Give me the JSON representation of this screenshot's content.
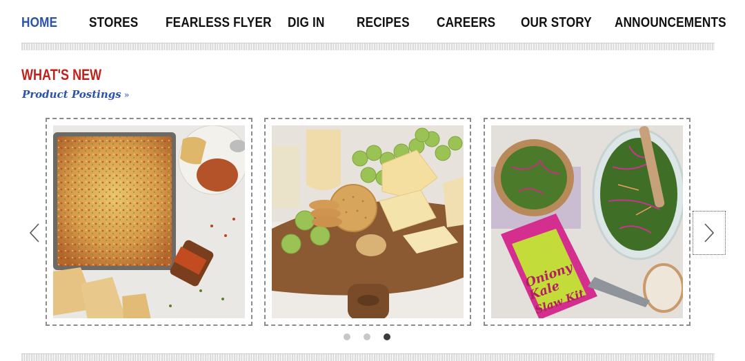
{
  "nav": {
    "items": [
      {
        "label": "HOME",
        "active": true
      },
      {
        "label": "STORES"
      },
      {
        "label": "FEARLESS FLYER"
      },
      {
        "label": "DIG IN"
      },
      {
        "label": "RECIPES"
      },
      {
        "label": "CAREERS"
      },
      {
        "label": "OUR STORY"
      },
      {
        "label": "ANNOUNCEMENTS"
      }
    ]
  },
  "section": {
    "heading": "WHAT'S NEW",
    "link_label": "Product Postings",
    "link_chevron": "»"
  },
  "carousel": {
    "slides": [
      {
        "name": "baked-cheese-dip-with-seasoning-jar",
        "description_icon": "food-photo"
      },
      {
        "name": "cheese-board-with-grapes-and-crackers",
        "description_icon": "food-photo"
      },
      {
        "name": "oniony-kale-slaw-kit-salad",
        "description_icon": "food-photo",
        "package_text": "Oniony Kale Slaw Kit"
      }
    ],
    "dots": 3,
    "active_dot": 2
  },
  "colors": {
    "accent_blue": "#2b53a7",
    "heading_red": "#c1201b",
    "nav_text": "#111111"
  }
}
